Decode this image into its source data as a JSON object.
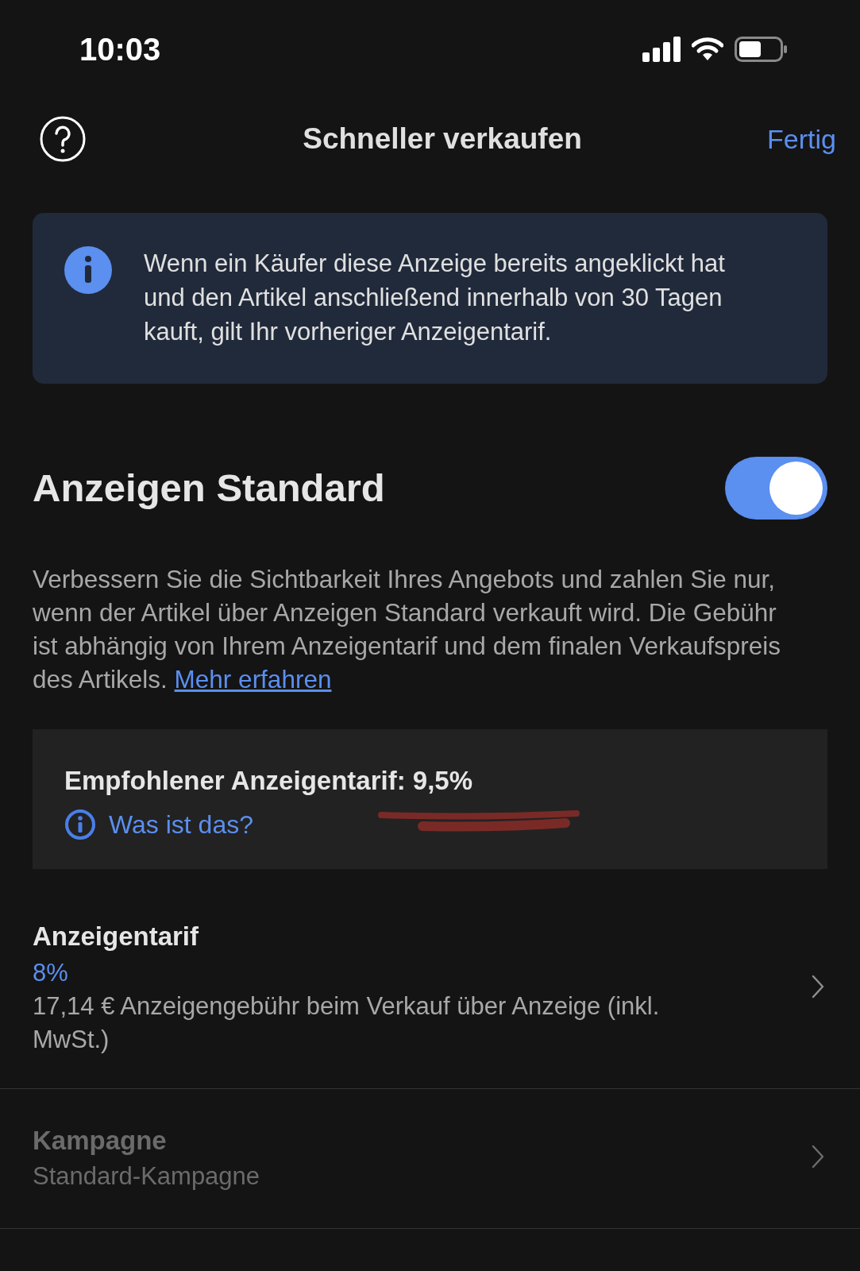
{
  "status_bar": {
    "time": "10:03"
  },
  "nav": {
    "title": "Schneller verkaufen",
    "done": "Fertig"
  },
  "info_banner": {
    "text": "Wenn ein Käufer diese Anzeige bereits angeklickt hat und den Artikel anschließend innerhalb von 30 Tagen kauft, gilt Ihr vorheriger Anzeigentarif."
  },
  "section": {
    "title": "Anzeigen Standard",
    "on": true,
    "description": "Verbessern Sie die Sichtbarkeit Ihres Angebots und zahlen Sie nur, wenn der Artikel über Anzeigen Standard verkauft wird. Die Gebühr ist abhängig von Ihrem Anzeigentarif und dem finalen Verkaufspreis des Artikels.",
    "link": "Mehr erfahren"
  },
  "recommendation": {
    "title": "Empfohlener Anzeigentarif: 9,5%",
    "link": "Was ist das?"
  },
  "rows": [
    {
      "label": "Anzeigentarif",
      "value": "8%",
      "detail": "17,14 € Anzeigengebühr beim Verkauf über Anzeige (inkl. MwSt.)",
      "disabled": false
    },
    {
      "label": "Kampagne",
      "value": "Standard-Kampagne",
      "disabled": true
    }
  ]
}
